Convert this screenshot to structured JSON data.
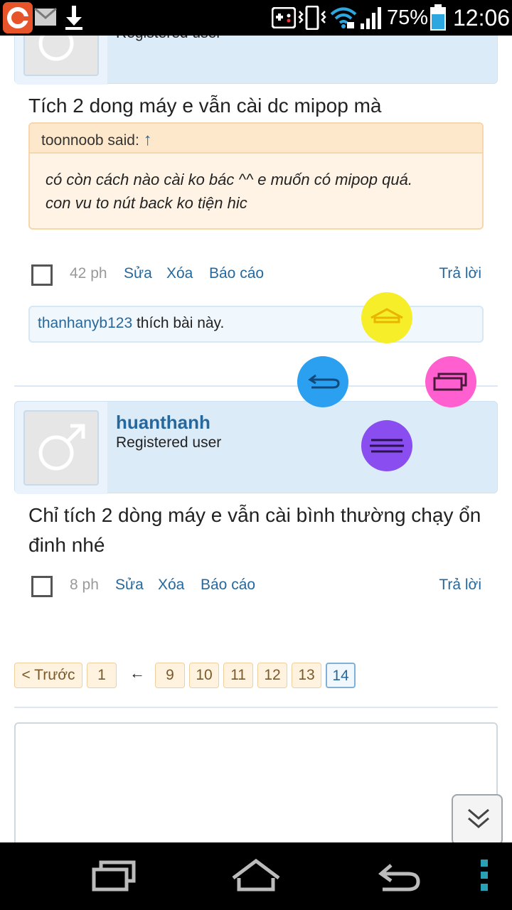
{
  "status_bar": {
    "battery_percent": "75%",
    "clock": "12:06",
    "icons": [
      "app-notification-icon",
      "email-icon",
      "download-icon",
      "gamepad-icon",
      "vibrate-icon",
      "wifi-icon",
      "signal-icon",
      "battery-icon"
    ]
  },
  "post1": {
    "usertitle_partial": "Registered user",
    "message": "Tích 2 dong máy e vẫn cài dc mipop mà",
    "quote": {
      "author": "toonnoob said:",
      "arrow": "↑",
      "text_line1": "có còn cách nào cài ko bác ^^ e muốn có mipop quá.",
      "text_line2": "con vu to nút back ko tiện hic"
    },
    "time": "42 ph",
    "edit": "Sửa",
    "delete": "Xóa",
    "report": "Báo cáo",
    "reply": "Trả lời",
    "likes": {
      "user": "thanhanyb123",
      "text": " thích bài này."
    }
  },
  "post2": {
    "username": "huanthanh",
    "usertitle": "Registered user",
    "message": "Chỉ tích 2 dòng máy e vẫn cài bình thường chạy ổn đinh nhé",
    "time": "8 ph",
    "edit": "Sửa",
    "delete": "Xóa",
    "report": "Báo cáo",
    "reply": "Trả lời"
  },
  "pagination": {
    "prev": "< Trước",
    "first": "1",
    "gap": "←",
    "pages": [
      "9",
      "10",
      "11",
      "12",
      "13"
    ],
    "current": "14"
  },
  "mipop_colors": {
    "home": "#f7ee2a",
    "back": "#2b9ff0",
    "recents": "#ff5fcf",
    "menu": "#8a4ef0"
  },
  "nav_bar": {
    "buttons": [
      "recents-icon",
      "home-icon",
      "back-icon",
      "overflow-menu-icon"
    ]
  }
}
